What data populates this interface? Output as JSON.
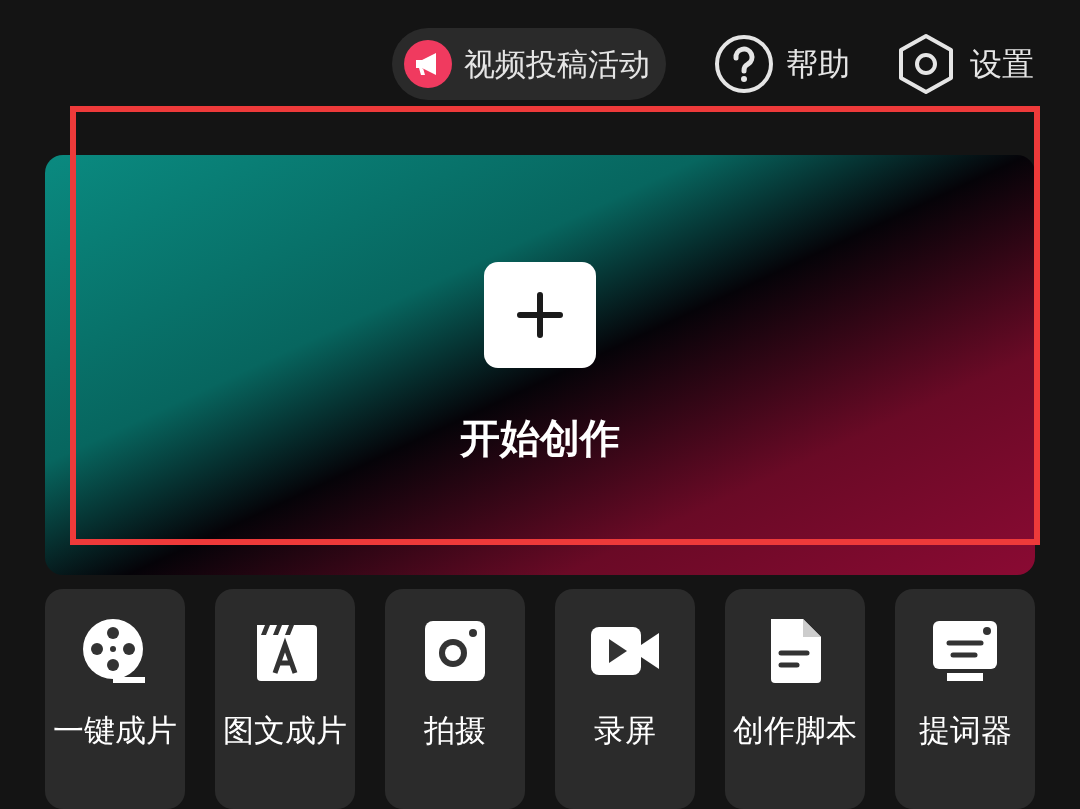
{
  "top_bar": {
    "campaign": {
      "label": "视频投稿活动"
    },
    "help": {
      "label": "帮助"
    },
    "settings": {
      "label": "设置"
    }
  },
  "create": {
    "label": "开始创作",
    "highlighted": true
  },
  "tools": [
    {
      "kind": "reel",
      "label": "一键成片"
    },
    {
      "kind": "text-image",
      "label": "图文成片"
    },
    {
      "kind": "camera",
      "label": "拍摄"
    },
    {
      "kind": "record",
      "label": "录屏"
    },
    {
      "kind": "script",
      "label": "创作脚本"
    },
    {
      "kind": "teleprompter",
      "label": "提词器"
    }
  ]
}
